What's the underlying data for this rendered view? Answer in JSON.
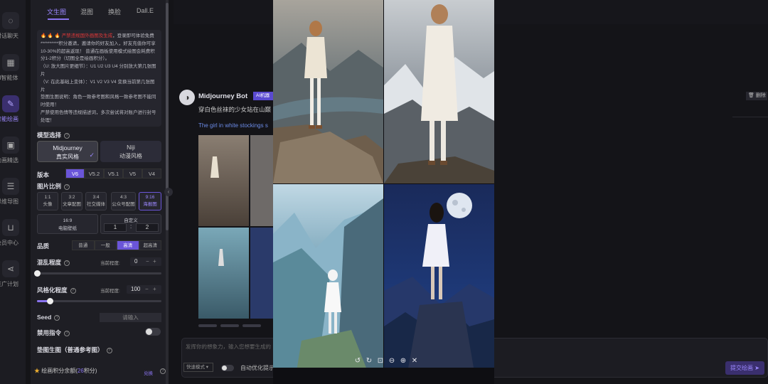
{
  "nav": [
    {
      "label": "对话聊天",
      "icon": "chat-icon",
      "glyph": "◌"
    },
    {
      "label": "AI智能体",
      "icon": "apps-icon",
      "glyph": "▦"
    },
    {
      "label": "智能绘画",
      "icon": "paint-brush-icon",
      "glyph": "✎",
      "active": true
    },
    {
      "label": "绘画精选",
      "icon": "image-icon",
      "glyph": "▣"
    },
    {
      "label": "思维导图",
      "icon": "mindmap-icon",
      "glyph": "☰"
    },
    {
      "label": "会员中心",
      "icon": "cart-icon",
      "glyph": "⊔"
    },
    {
      "label": "推广计划",
      "icon": "share-icon",
      "glyph": "⋖"
    }
  ],
  "panel": {
    "tabs": [
      "文生图",
      "混图",
      "换脸",
      "Dall.E"
    ],
    "notice": {
      "fires": "🔥 🔥 🔥",
      "warning": "严禁违规国外画图及生成",
      "line1": "，登录即可体验免费**********积分邀请，邀请你的好友加入，好友充值你可享10-30%的超高返现！ 普通在画板使用模式绘图会耗费积分1-2积分（切图全是绘画积分）。",
      "line2": "（U: 放大图片更细节）：U1 U2 U3 U4 分别放大第几张图片",
      "line3": "（V: 在此基础上变体）：V1 V2 V3 V4 变换当前第几张图片",
      "line4": "垫图生图说明：角色一致参考图和风格一致参考图不能同时使用！",
      "line5": "严禁使用色情等违规描述词，多次尝试将对账户进行封号处理！"
    },
    "model_label": "模型选择",
    "models": [
      {
        "name": "Midjourney",
        "sub": "真实风格",
        "selected": true
      },
      {
        "name": "Niji",
        "sub": "动漫风格",
        "selected": false
      }
    ],
    "version_label": "版本",
    "versions": [
      "V6",
      "V5.2",
      "V5.1",
      "V5",
      "V4"
    ],
    "active_version": "V6",
    "ratio_label": "图片比例",
    "ratios": [
      {
        "ratio": "1:1",
        "use": "头像"
      },
      {
        "ratio": "3:2",
        "use": "文章配图"
      },
      {
        "ratio": "3:4",
        "use": "社交媒体"
      },
      {
        "ratio": "4:3",
        "use": "公众号配图"
      },
      {
        "ratio": "9:16",
        "use": "海报图",
        "active": true
      }
    ],
    "ratio_wide": {
      "ratio": "16:9",
      "use": "电脑壁纸"
    },
    "ratio_custom": {
      "label": "自定义",
      "w": "1",
      "sep": ":",
      "h": "2"
    },
    "quality_label": "品质",
    "qualities": [
      "普通",
      "一般",
      "高清",
      "超高清"
    ],
    "active_quality": "高清",
    "chaos_label": "混乱程度",
    "current_label": "当前程度:",
    "chaos_value": "0",
    "chaos_fraction": 0.0,
    "stylize_label": "风格化程度",
    "stylize_value": "100",
    "stylize_fraction": 0.1,
    "seed_label": "Seed",
    "seed_placeholder": "请输入",
    "noprompt_label": "禁用指令",
    "ref_label": "垫图生图（普通参考图）",
    "credits_prefix": "绘画积分余额(",
    "credits_value": "26",
    "credits_suffix": "积分)",
    "redeem_label": "兑换"
  },
  "chat": {
    "bot_name": "Midjourney Bot",
    "badge": "AI机器人",
    "prompt_cn": "穿白色丝袜的少女站在山巅",
    "prompt_en": "The girl in white stockings s",
    "delete_label": "删除",
    "input_placeholder": "发挥你的想象力，输入您想要生成的",
    "mode_label": "快速模式",
    "auto_option": "自动优化提示",
    "submit_label": "提交绘画"
  },
  "viewer": {
    "images": [
      "girl-back-cliff",
      "girl-white-dress-mountain",
      "girl-blue-valley",
      "girl-moon-night"
    ]
  },
  "colors": {
    "accent": "#8a74f0",
    "accent_bg": "#3a2f6e",
    "warning": "#e03838",
    "link": "#6c8ce8"
  }
}
